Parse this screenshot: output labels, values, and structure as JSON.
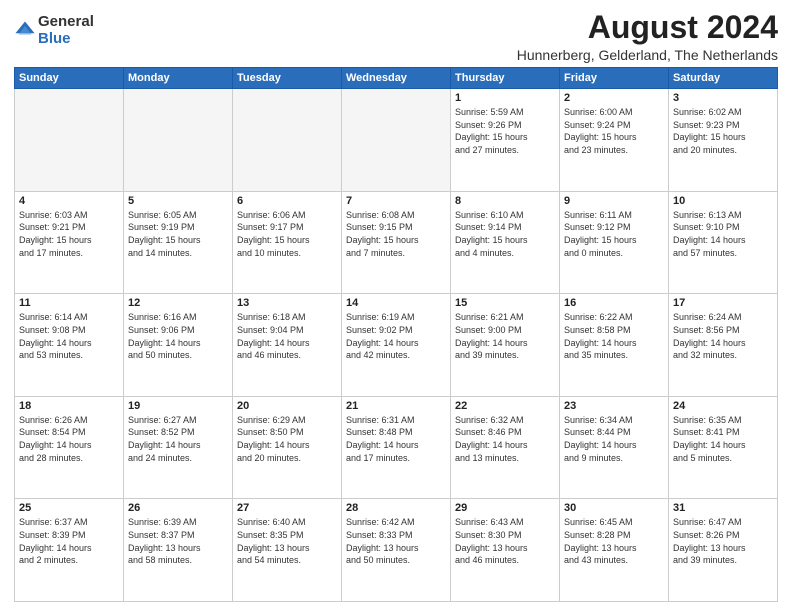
{
  "logo": {
    "general": "General",
    "blue": "Blue"
  },
  "title": {
    "month_year": "August 2024",
    "location": "Hunnerberg, Gelderland, The Netherlands"
  },
  "headers": [
    "Sunday",
    "Monday",
    "Tuesday",
    "Wednesday",
    "Thursday",
    "Friday",
    "Saturday"
  ],
  "weeks": [
    [
      {
        "day": "",
        "info": ""
      },
      {
        "day": "",
        "info": ""
      },
      {
        "day": "",
        "info": ""
      },
      {
        "day": "",
        "info": ""
      },
      {
        "day": "1",
        "info": "Sunrise: 5:59 AM\nSunset: 9:26 PM\nDaylight: 15 hours\nand 27 minutes."
      },
      {
        "day": "2",
        "info": "Sunrise: 6:00 AM\nSunset: 9:24 PM\nDaylight: 15 hours\nand 23 minutes."
      },
      {
        "day": "3",
        "info": "Sunrise: 6:02 AM\nSunset: 9:23 PM\nDaylight: 15 hours\nand 20 minutes."
      }
    ],
    [
      {
        "day": "4",
        "info": "Sunrise: 6:03 AM\nSunset: 9:21 PM\nDaylight: 15 hours\nand 17 minutes."
      },
      {
        "day": "5",
        "info": "Sunrise: 6:05 AM\nSunset: 9:19 PM\nDaylight: 15 hours\nand 14 minutes."
      },
      {
        "day": "6",
        "info": "Sunrise: 6:06 AM\nSunset: 9:17 PM\nDaylight: 15 hours\nand 10 minutes."
      },
      {
        "day": "7",
        "info": "Sunrise: 6:08 AM\nSunset: 9:15 PM\nDaylight: 15 hours\nand 7 minutes."
      },
      {
        "day": "8",
        "info": "Sunrise: 6:10 AM\nSunset: 9:14 PM\nDaylight: 15 hours\nand 4 minutes."
      },
      {
        "day": "9",
        "info": "Sunrise: 6:11 AM\nSunset: 9:12 PM\nDaylight: 15 hours\nand 0 minutes."
      },
      {
        "day": "10",
        "info": "Sunrise: 6:13 AM\nSunset: 9:10 PM\nDaylight: 14 hours\nand 57 minutes."
      }
    ],
    [
      {
        "day": "11",
        "info": "Sunrise: 6:14 AM\nSunset: 9:08 PM\nDaylight: 14 hours\nand 53 minutes."
      },
      {
        "day": "12",
        "info": "Sunrise: 6:16 AM\nSunset: 9:06 PM\nDaylight: 14 hours\nand 50 minutes."
      },
      {
        "day": "13",
        "info": "Sunrise: 6:18 AM\nSunset: 9:04 PM\nDaylight: 14 hours\nand 46 minutes."
      },
      {
        "day": "14",
        "info": "Sunrise: 6:19 AM\nSunset: 9:02 PM\nDaylight: 14 hours\nand 42 minutes."
      },
      {
        "day": "15",
        "info": "Sunrise: 6:21 AM\nSunset: 9:00 PM\nDaylight: 14 hours\nand 39 minutes."
      },
      {
        "day": "16",
        "info": "Sunrise: 6:22 AM\nSunset: 8:58 PM\nDaylight: 14 hours\nand 35 minutes."
      },
      {
        "day": "17",
        "info": "Sunrise: 6:24 AM\nSunset: 8:56 PM\nDaylight: 14 hours\nand 32 minutes."
      }
    ],
    [
      {
        "day": "18",
        "info": "Sunrise: 6:26 AM\nSunset: 8:54 PM\nDaylight: 14 hours\nand 28 minutes."
      },
      {
        "day": "19",
        "info": "Sunrise: 6:27 AM\nSunset: 8:52 PM\nDaylight: 14 hours\nand 24 minutes."
      },
      {
        "day": "20",
        "info": "Sunrise: 6:29 AM\nSunset: 8:50 PM\nDaylight: 14 hours\nand 20 minutes."
      },
      {
        "day": "21",
        "info": "Sunrise: 6:31 AM\nSunset: 8:48 PM\nDaylight: 14 hours\nand 17 minutes."
      },
      {
        "day": "22",
        "info": "Sunrise: 6:32 AM\nSunset: 8:46 PM\nDaylight: 14 hours\nand 13 minutes."
      },
      {
        "day": "23",
        "info": "Sunrise: 6:34 AM\nSunset: 8:44 PM\nDaylight: 14 hours\nand 9 minutes."
      },
      {
        "day": "24",
        "info": "Sunrise: 6:35 AM\nSunset: 8:41 PM\nDaylight: 14 hours\nand 5 minutes."
      }
    ],
    [
      {
        "day": "25",
        "info": "Sunrise: 6:37 AM\nSunset: 8:39 PM\nDaylight: 14 hours\nand 2 minutes."
      },
      {
        "day": "26",
        "info": "Sunrise: 6:39 AM\nSunset: 8:37 PM\nDaylight: 13 hours\nand 58 minutes."
      },
      {
        "day": "27",
        "info": "Sunrise: 6:40 AM\nSunset: 8:35 PM\nDaylight: 13 hours\nand 54 minutes."
      },
      {
        "day": "28",
        "info": "Sunrise: 6:42 AM\nSunset: 8:33 PM\nDaylight: 13 hours\nand 50 minutes."
      },
      {
        "day": "29",
        "info": "Sunrise: 6:43 AM\nSunset: 8:30 PM\nDaylight: 13 hours\nand 46 minutes."
      },
      {
        "day": "30",
        "info": "Sunrise: 6:45 AM\nSunset: 8:28 PM\nDaylight: 13 hours\nand 43 minutes."
      },
      {
        "day": "31",
        "info": "Sunrise: 6:47 AM\nSunset: 8:26 PM\nDaylight: 13 hours\nand 39 minutes."
      }
    ]
  ]
}
